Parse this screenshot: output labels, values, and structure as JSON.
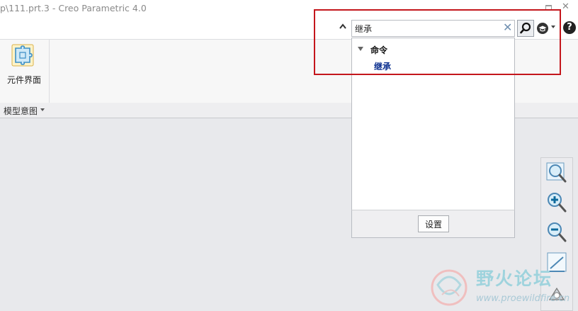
{
  "window": {
    "title": "p\\111.prt.3 - Creo Parametric 4.0"
  },
  "search": {
    "value": "继承",
    "clear_icon": "✕"
  },
  "help": {
    "label": "?"
  },
  "ribbon": {
    "component_interface_label": "元件界面",
    "group_label": "模型意图"
  },
  "results": {
    "category_label": "命令",
    "items": [
      {
        "label": "继承"
      }
    ],
    "settings_label": "设置"
  },
  "watermark": {
    "text": "野火论坛",
    "url": "www.proewildfire.cn"
  },
  "colors": {
    "highlight": "#c4161c",
    "result_link": "#0b2f8f"
  },
  "icons": {
    "collapse": "chevron-up-icon",
    "search": "search-icon",
    "help": "help-icon",
    "learning": "graduation-cap-icon",
    "component": "puzzle-icon",
    "zoom_fit": "zoom-fit-icon",
    "zoom_in": "zoom-in-icon",
    "zoom_out": "zoom-out-icon",
    "repaint": "repaint-icon"
  }
}
